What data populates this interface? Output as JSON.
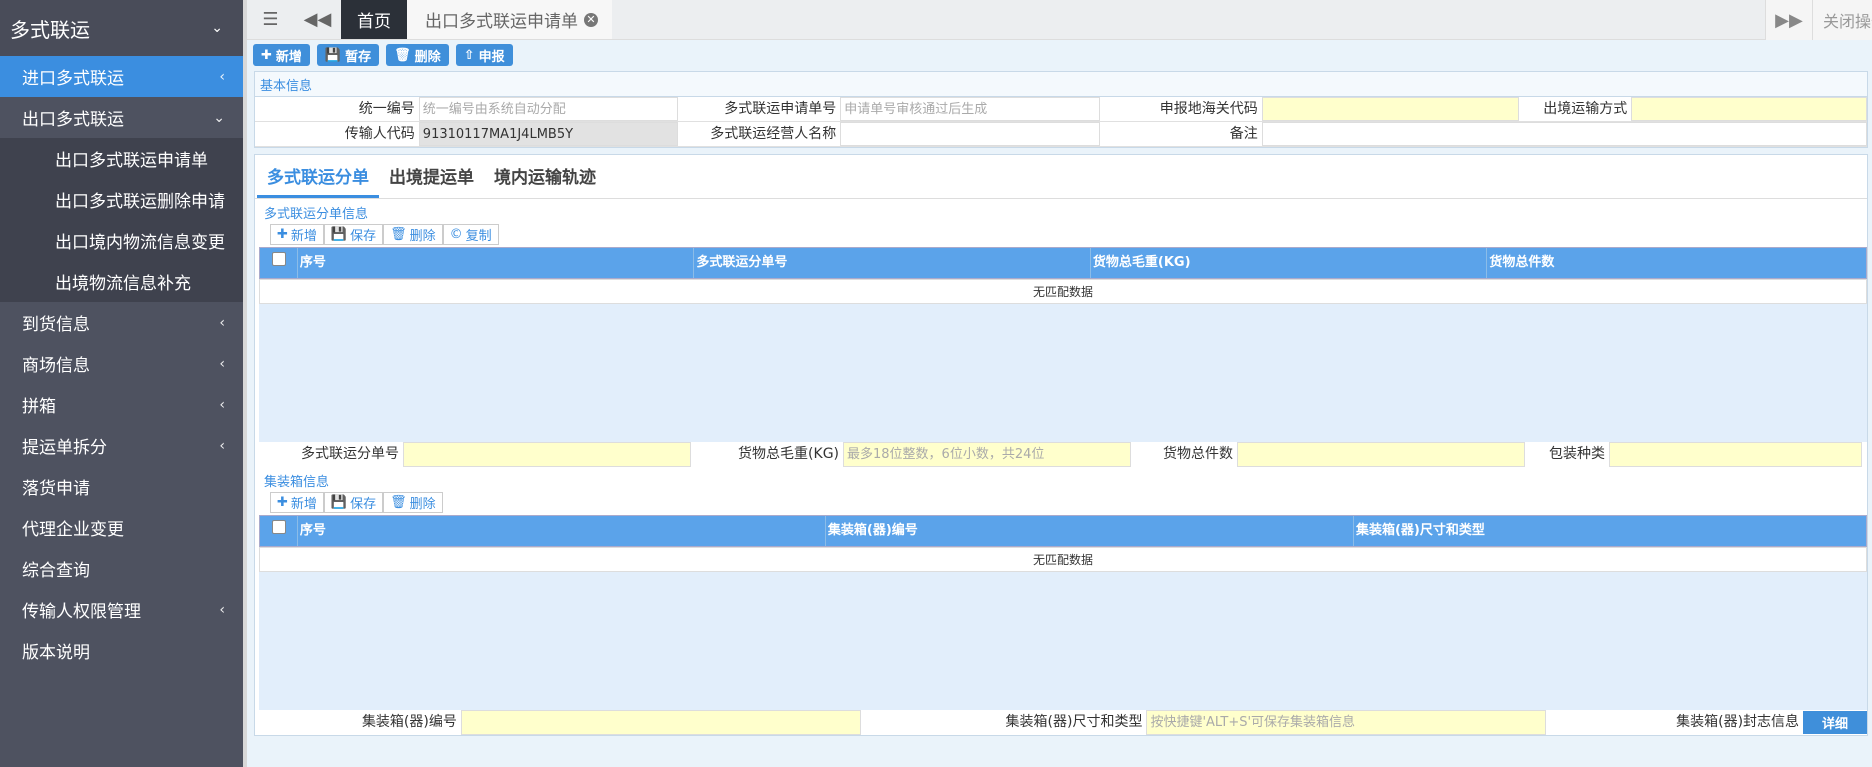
{
  "sidebar": {
    "title": "多式联运",
    "items": [
      {
        "label": "进口多式联运",
        "icon": "chevron-left-icon"
      },
      {
        "label": "出口多式联运",
        "icon": "chevron-down-icon"
      },
      {
        "label": "到货信息",
        "icon": "chevron-left-icon"
      },
      {
        "label": "商场信息",
        "icon": "chevron-left-icon"
      },
      {
        "label": "拼箱",
        "icon": "chevron-left-icon"
      },
      {
        "label": "提运单拆分",
        "icon": "chevron-left-icon"
      },
      {
        "label": "落货申请"
      },
      {
        "label": "代理企业变更"
      },
      {
        "label": "综合查询"
      },
      {
        "label": "传输人权限管理",
        "icon": "chevron-left-icon"
      },
      {
        "label": "版本说明"
      }
    ],
    "sub_items": [
      "出口多式联运申请单",
      "出口多式联运删除申请",
      "出口境内物流信息变更",
      "出境物流信息补充"
    ]
  },
  "topbar": {
    "home_tab": "首页",
    "active_tab": "出口多式联运申请单",
    "close_ops": "关闭操作"
  },
  "toolbar": {
    "new": "新增",
    "save_draft": "暂存",
    "delete": "删除",
    "declare": "申报"
  },
  "basic_info": {
    "title": "基本信息",
    "unified_no_label": "统一编号",
    "unified_no_placeholder": "统一编号由系统自动分配",
    "apply_no_label": "多式联运申请单号",
    "apply_no_placeholder": "申请单号审核通过后生成",
    "customs_code_label": "申报地海关代码",
    "transport_mode_label": "出境运输方式",
    "transmitter_code_label": "传输人代码",
    "transmitter_code_value": "91310117MA1J4LMB5Y",
    "operator_name_label": "多式联运经营人名称",
    "remark_label": "备注"
  },
  "tabs": [
    "多式联运分单",
    "出境提运单",
    "境内运输轨迹"
  ],
  "split": {
    "title": "多式联运分单信息",
    "btn_new": "新增",
    "btn_save": "保存",
    "btn_delete": "删除",
    "btn_copy": "复制",
    "columns": [
      "序号",
      "多式联运分单号",
      "货物总毛重(KG)",
      "货物总件数"
    ],
    "no_data": "无匹配数据",
    "form": {
      "split_no_label": "多式联运分单号",
      "gross_weight_label": "货物总毛重(KG)",
      "gross_weight_placeholder": "最多18位整数，6位小数，共24位",
      "total_pieces_label": "货物总件数",
      "package_type_label": "包装种类"
    }
  },
  "container": {
    "title": "集装箱信息",
    "btn_new": "新增",
    "btn_save": "保存",
    "btn_delete": "删除",
    "columns": [
      "序号",
      "集装箱(器)编号",
      "集装箱(器)尺寸和类型"
    ],
    "no_data": "无匹配数据",
    "form": {
      "container_no_label": "集装箱(器)编号",
      "size_type_label": "集装箱(器)尺寸和类型",
      "size_type_placeholder": "按快捷键'ALT+S'可保存集装箱信息",
      "seal_label": "集装箱(器)封志信息",
      "detail_btn": "详细"
    }
  }
}
